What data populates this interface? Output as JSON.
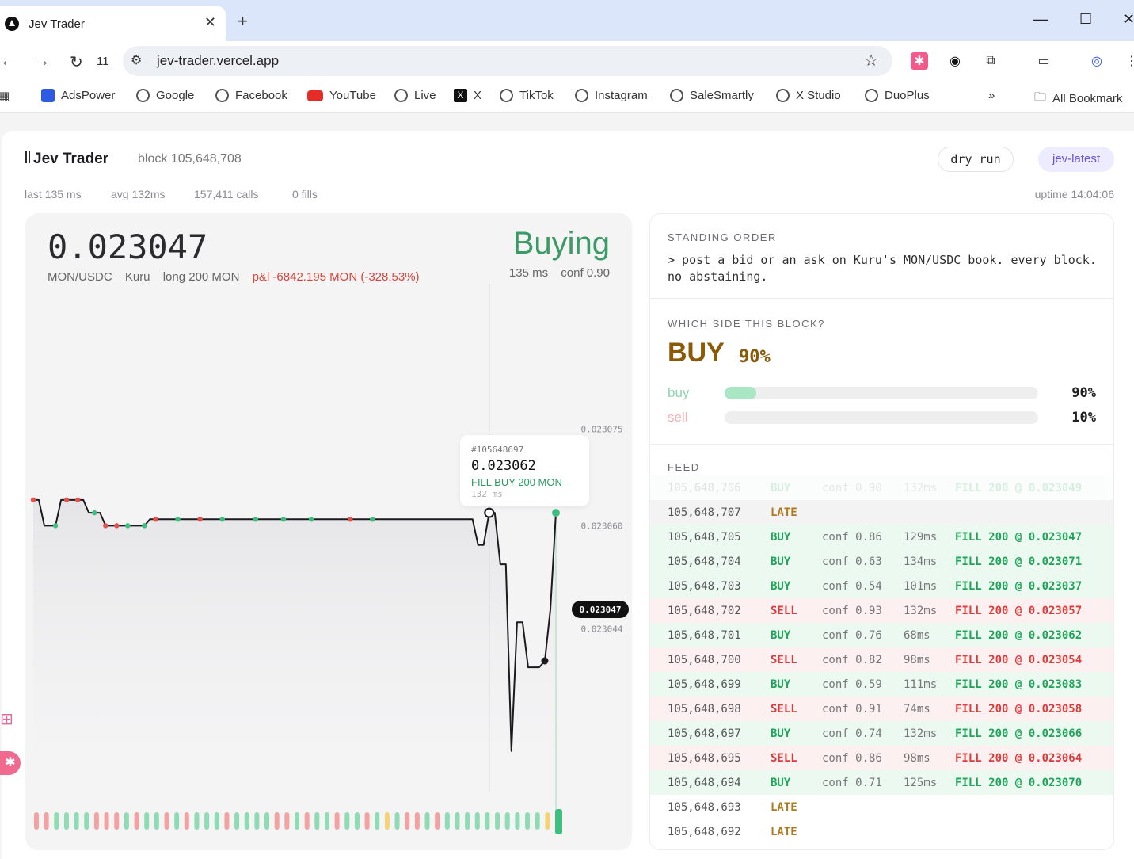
{
  "browser": {
    "tab_title": "Jev Trader",
    "reload_count": "11",
    "url": "jev-trader.vercel.app",
    "bookmarks": [
      "AdsPower",
      "Google",
      "Facebook",
      "YouTube",
      "Live",
      "X",
      "TikTok",
      "Instagram",
      "SaleSmartly",
      "X Studio",
      "DuoPlus"
    ],
    "all_bookmarks": "All Bookmark"
  },
  "header": {
    "brand": "Jev Trader",
    "block": "block 105,648,708",
    "dry_run": "dry run",
    "model": "jev-latest",
    "last": "last 135 ms",
    "avg": "avg 132ms",
    "calls": "157,411 calls",
    "fills": "0 fills",
    "uptime": "uptime 14:04:06"
  },
  "ticker": {
    "price": "0.023047",
    "pair": "MON/USDC",
    "venue": "Kuru",
    "position": "long 200 MON",
    "pnl": "p&l -6842.195 MON (-328.53%)",
    "state": "Buying",
    "latency": "135 ms",
    "conf": "conf 0.90"
  },
  "tooltip": {
    "block": "#105648697",
    "price": "0.023062",
    "fill": "FILL BUY 200 MON",
    "ms": "132 ms"
  },
  "chart_data": {
    "type": "line",
    "y_ticks": [
      "0.023075",
      "0.023060",
      "0.023044"
    ],
    "current_label": "0.023047",
    "ylim": [
      0.023015,
      0.023095
    ],
    "grid": false,
    "series": [
      {
        "values": [
          0.023064,
          0.023064,
          0.02306,
          0.02306,
          0.02306,
          0.023064,
          0.023064,
          0.023064,
          0.023064,
          0.023064,
          0.023062,
          0.023062,
          0.023062,
          0.02306,
          0.02306,
          0.02306,
          0.02306,
          0.02306,
          0.02306,
          0.02306,
          0.02306,
          0.023061,
          0.023061,
          0.023061,
          0.023061,
          0.023061,
          0.023061,
          0.023061,
          0.023061,
          0.023061,
          0.023061,
          0.023061,
          0.023061,
          0.023061,
          0.023061,
          0.023061,
          0.023061,
          0.023061,
          0.023061,
          0.023061,
          0.023061,
          0.023061,
          0.023061,
          0.023061,
          0.023061,
          0.023061,
          0.023061,
          0.023061,
          0.023061,
          0.023061,
          0.023061,
          0.023061,
          0.023061,
          0.023061,
          0.023061,
          0.023061,
          0.023061,
          0.023061,
          0.023061,
          0.023061,
          0.023061,
          0.023061,
          0.023061,
          0.023061,
          0.023061,
          0.023061,
          0.023061,
          0.023061,
          0.023061,
          0.023061,
          0.023061,
          0.023061,
          0.023061,
          0.023061,
          0.023061,
          0.023061,
          0.023061,
          0.023061,
          0.023061,
          0.023061,
          0.023057,
          0.023057,
          0.023062,
          0.023062,
          0.023054,
          0.023054,
          0.023025,
          0.023045,
          0.023045,
          0.023038,
          0.023038,
          0.023038,
          0.023039,
          0.023047,
          0.023062
        ]
      }
    ],
    "markers": [
      {
        "i": 0,
        "side": "sell"
      },
      {
        "i": 4,
        "side": "buy"
      },
      {
        "i": 6,
        "side": "sell"
      },
      {
        "i": 8,
        "side": "sell"
      },
      {
        "i": 11,
        "side": "buy"
      },
      {
        "i": 13,
        "side": "sell"
      },
      {
        "i": 15,
        "side": "sell"
      },
      {
        "i": 17,
        "side": "buy"
      },
      {
        "i": 20,
        "side": "buy"
      },
      {
        "i": 22,
        "side": "sell"
      },
      {
        "i": 26,
        "side": "buy"
      },
      {
        "i": 30,
        "side": "sell"
      },
      {
        "i": 34,
        "side": "buy"
      },
      {
        "i": 40,
        "side": "buy"
      },
      {
        "i": 45,
        "side": "buy"
      },
      {
        "i": 50,
        "side": "buy"
      },
      {
        "i": 57,
        "side": "sell"
      },
      {
        "i": 61,
        "side": "buy"
      }
    ],
    "volume_bars": [
      "sell",
      "sell",
      "buy",
      "buy",
      "buy",
      "buy",
      "sell",
      "sell",
      "sell",
      "buy",
      "sell",
      "buy",
      "buy",
      "sell",
      "buy",
      "sell",
      "buy",
      "buy",
      "buy",
      "sell",
      "buy",
      "buy",
      "buy",
      "buy",
      "sell",
      "sell",
      "buy",
      "sell",
      "buy",
      "buy",
      "sell",
      "buy",
      "buy",
      "sell",
      "buy",
      "late",
      "buy",
      "sell",
      "sell",
      "buy",
      "sell",
      "buy",
      "buy",
      "buy",
      "buy",
      "buy",
      "buy",
      "buy",
      "buy",
      "buy",
      "buy",
      "late",
      "buy"
    ]
  },
  "standing_order": {
    "label": "STANDING ORDER",
    "text": "> post a bid or an ask on Kuru's MON/USDC book. every block. no abstaining."
  },
  "side": {
    "label": "WHICH SIDE THIS BLOCK?",
    "decision": "BUY",
    "pct": "90%",
    "buy_label": "buy",
    "buy_pct": "90%",
    "buy_frac": 0.1,
    "sell_label": "sell",
    "sell_pct": "10%",
    "sell_frac": 0.0,
    "buy_color": "#a8e6c4",
    "sell_color": "#f3c4c4"
  },
  "feed": {
    "label": "FEED",
    "rows": [
      {
        "block": "105,648,706",
        "side": "BUY",
        "conf": "conf 0.90",
        "ms": "132ms",
        "fill": "FILL 200 @ 0.023049",
        "kind": "buy faded"
      },
      {
        "block": "105,648,707",
        "side": "LATE",
        "conf": "",
        "ms": "",
        "fill": "",
        "kind": "late shade"
      },
      {
        "block": "105,648,705",
        "side": "BUY",
        "conf": "conf 0.86",
        "ms": "129ms",
        "fill": "FILL 200 @ 0.023047",
        "kind": "buy"
      },
      {
        "block": "105,648,704",
        "side": "BUY",
        "conf": "conf 0.63",
        "ms": "134ms",
        "fill": "FILL 200 @ 0.023071",
        "kind": "buy"
      },
      {
        "block": "105,648,703",
        "side": "BUY",
        "conf": "conf 0.54",
        "ms": "101ms",
        "fill": "FILL 200 @ 0.023037",
        "kind": "buy"
      },
      {
        "block": "105,648,702",
        "side": "SELL",
        "conf": "conf 0.93",
        "ms": "132ms",
        "fill": "FILL 200 @ 0.023057",
        "kind": "sell"
      },
      {
        "block": "105,648,701",
        "side": "BUY",
        "conf": "conf 0.76",
        "ms": "68ms",
        "fill": "FILL 200 @ 0.023062",
        "kind": "buy"
      },
      {
        "block": "105,648,700",
        "side": "SELL",
        "conf": "conf 0.82",
        "ms": "98ms",
        "fill": "FILL 200 @ 0.023054",
        "kind": "sell"
      },
      {
        "block": "105,648,699",
        "side": "BUY",
        "conf": "conf 0.59",
        "ms": "111ms",
        "fill": "FILL 200 @ 0.023083",
        "kind": "buy"
      },
      {
        "block": "105,648,698",
        "side": "SELL",
        "conf": "conf 0.91",
        "ms": "74ms",
        "fill": "FILL 200 @ 0.023058",
        "kind": "sell"
      },
      {
        "block": "105,648,697",
        "side": "BUY",
        "conf": "conf 0.74",
        "ms": "132ms",
        "fill": "FILL 200 @ 0.023066",
        "kind": "buy"
      },
      {
        "block": "105,648,695",
        "side": "SELL",
        "conf": "conf 0.86",
        "ms": "98ms",
        "fill": "FILL 200 @ 0.023064",
        "kind": "sell"
      },
      {
        "block": "105,648,694",
        "side": "BUY",
        "conf": "conf 0.71",
        "ms": "125ms",
        "fill": "FILL 200 @ 0.023070",
        "kind": "buy"
      },
      {
        "block": "105,648,693",
        "side": "LATE",
        "conf": "",
        "ms": "",
        "fill": "",
        "kind": "late"
      },
      {
        "block": "105,648,692",
        "side": "LATE",
        "conf": "",
        "ms": "",
        "fill": "",
        "kind": "late"
      }
    ]
  },
  "colors": {
    "buy": "#3fbf7f",
    "sell": "#e2534d",
    "late": "#f2c94c",
    "accent": "#6a55d8"
  },
  "icons": [
    "back-arrow-icon",
    "forward-arrow-icon",
    "reload-icon",
    "site-settings-icon",
    "bookmark-star-icon",
    "extensions-icon",
    "profile-icon",
    "menu-icon"
  ]
}
